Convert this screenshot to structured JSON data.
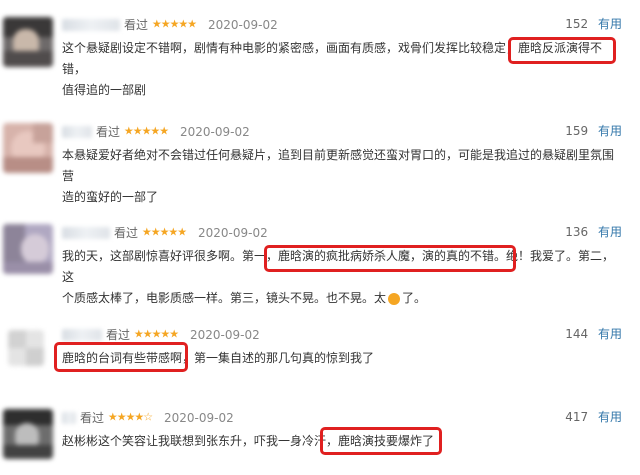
{
  "reviews": [
    {
      "rated_label": "看过",
      "stars": "★★★★★",
      "date": "2020-09-02",
      "votes": "152",
      "useful_label": "有用",
      "text_lines": [
        "这个悬疑剧设定不错啊，剧情有种电影的紧密感，画面有质感，戏骨们发挥比较稳定，鹿晗反派演得不错，",
        "值得追的一部剧"
      ],
      "highlight": "鹿晗反派演得不错"
    },
    {
      "rated_label": "看过",
      "stars": "★★★★★",
      "date": "2020-09-02",
      "votes": "159",
      "useful_label": "有用",
      "text_lines": [
        "本悬疑爱好者绝对不会错过任何悬疑片，追到目前更新感觉还蛮对胃口的，可能是我追过的悬疑剧里氛围营",
        "造的蛮好的一部了"
      ]
    },
    {
      "rated_label": "看过",
      "stars": "★★★★★",
      "date": "2020-09-02",
      "votes": "136",
      "useful_label": "有用",
      "text_lines": [
        "我的天，这部剧惊喜好评很多啊。第一，鹿晗演的疯批病娇杀人魔，演的真的不错。绝！我爱了。第二，这",
        "个质感太棒了，电影质感一样。第三，镜头不晃。也不晃。太",
        "了。"
      ],
      "highlight": "鹿晗演的疯批病娇杀人魔，演的真的不错。"
    },
    {
      "rated_label": "看过",
      "stars": "★★★★★",
      "date": "2020-09-02",
      "votes": "144",
      "useful_label": "有用",
      "text_lines": [
        "鹿晗的台词有些带感啊，第一集自述的那几句真的惊到我了"
      ],
      "highlight": "鹿晗的台词有些带感啊"
    },
    {
      "rated_label": "看过",
      "stars": "★★★★☆",
      "date": "2020-09-02",
      "votes": "417",
      "useful_label": "有用",
      "text_lines": [
        "赵彬彬这个笑容让我联想到张东升，吓我一身冷汗，鹿晗演技要爆炸了"
      ],
      "highlight": "鹿晗演技要爆炸了"
    }
  ],
  "colors": {
    "star": "#f5a623",
    "link": "#3377aa",
    "highlight_box": "#e02020",
    "text": "#333333"
  },
  "icons": [
    "blurred-avatar",
    "star-rating",
    "smile-emoji-icon"
  ]
}
